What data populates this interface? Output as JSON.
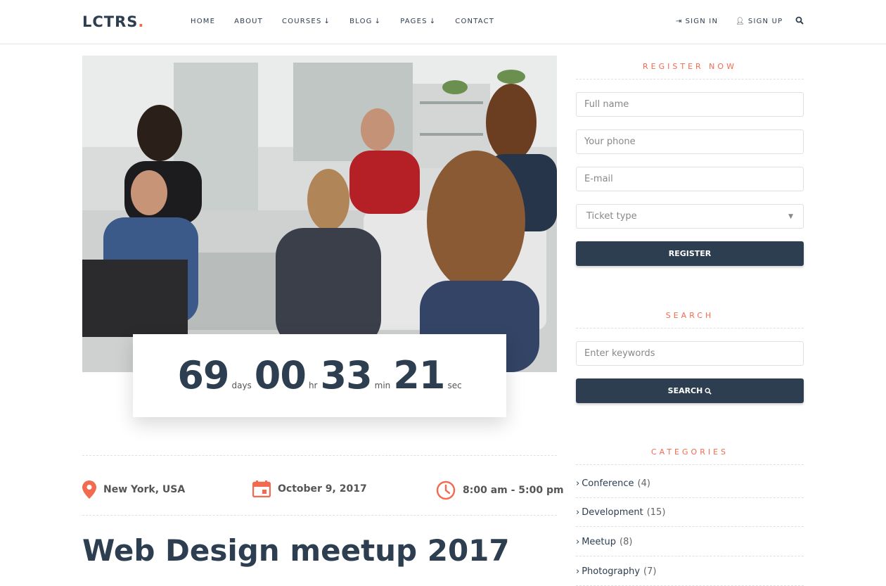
{
  "header": {
    "logo_text": "LCTRS",
    "logo_dot": ".",
    "nav": [
      {
        "label": "HOME",
        "dropdown": false
      },
      {
        "label": "ABOUT",
        "dropdown": false
      },
      {
        "label": "COURSES",
        "dropdown": true
      },
      {
        "label": "BLOG",
        "dropdown": true
      },
      {
        "label": "PAGES",
        "dropdown": true
      },
      {
        "label": "CONTACT",
        "dropdown": false
      }
    ],
    "sign_in": "SIGN IN",
    "sign_up": "SIGN UP"
  },
  "countdown": {
    "days": "69",
    "days_label": "days",
    "hours": "00",
    "hours_label": "hr",
    "minutes": "33",
    "minutes_label": "min",
    "seconds": "21",
    "seconds_label": "sec"
  },
  "event": {
    "location": "New York, USA",
    "date": "October 9, 2017",
    "time": "8:00 am - 5:00 pm",
    "title": "Web Design meetup 2017"
  },
  "register": {
    "title": "REGISTER NOW",
    "full_name_placeholder": "Full name",
    "phone_placeholder": "Your phone",
    "email_placeholder": "E-mail",
    "ticket_type": "Ticket type",
    "button": "REGISTER"
  },
  "search": {
    "title": "SEARCH",
    "placeholder": "Enter keywords",
    "button": "SEARCH"
  },
  "categories": {
    "title": "CATEGORIES",
    "items": [
      {
        "name": "Conference",
        "count": "(4)"
      },
      {
        "name": "Development",
        "count": "(15)"
      },
      {
        "name": "Meetup",
        "count": "(8)"
      },
      {
        "name": "Photography",
        "count": "(7)"
      }
    ]
  },
  "colors": {
    "accent": "#f26a4f",
    "primary": "#2c3e50"
  }
}
